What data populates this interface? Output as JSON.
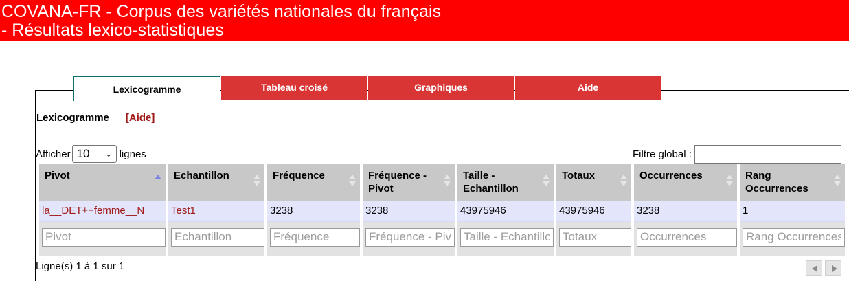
{
  "header": {
    "line1": "COVANA-FR - Corpus des variétés nationales du français",
    "line2": "- Résultats lexico-statistiques"
  },
  "tabs": [
    {
      "label": "Lexicogramme",
      "active": true
    },
    {
      "label": "Tableau croisé",
      "active": false
    },
    {
      "label": "Graphiques",
      "active": false
    },
    {
      "label": "Aide",
      "active": false
    }
  ],
  "section": {
    "title": "Lexicogramme",
    "help_link": "[Aide]"
  },
  "length_control": {
    "prefix": "Afficher",
    "value": "10",
    "suffix": "lignes"
  },
  "global_filter": {
    "label": "Filtre global :",
    "value": ""
  },
  "table": {
    "columns": [
      {
        "label": "Pivot",
        "sort": "asc"
      },
      {
        "label": "Echantillon",
        "sort": "both"
      },
      {
        "label": "Fréquence",
        "sort": "both"
      },
      {
        "label": "Fréquence - Pivot",
        "sort": "both"
      },
      {
        "label": "Taille - Echantillon",
        "sort": "both"
      },
      {
        "label": "Totaux",
        "sort": "both"
      },
      {
        "label": "Occurrences",
        "sort": "both"
      },
      {
        "label": "Rang Occurrences",
        "sort": "both"
      }
    ],
    "rows": [
      [
        "la__DET++femme__N",
        "Test1",
        "3238",
        "3238",
        "43975946",
        "43975946",
        "3238",
        "1"
      ]
    ],
    "filter_placeholders": [
      "Pivot",
      "Echantillon",
      "Fréquence",
      "Fréquence - Pivot",
      "Taille - Echantillon",
      "Totaux",
      "Occurrences",
      "Rang Occurrences"
    ]
  },
  "footer": {
    "info": "Ligne(s) 1 à 1 sur 1"
  },
  "colors": {
    "banner": "#ff0000",
    "tab_inactive": "#d93535",
    "link": "#a11a1a",
    "row_bg": "#e3e5fb",
    "header_bg": "#c8c8c8"
  },
  "icons": {
    "sort_asc": "triangle-up-icon",
    "sort_both": "updown-triangle-icon",
    "prev": "triangle-left-icon",
    "next": "triangle-right-icon"
  }
}
